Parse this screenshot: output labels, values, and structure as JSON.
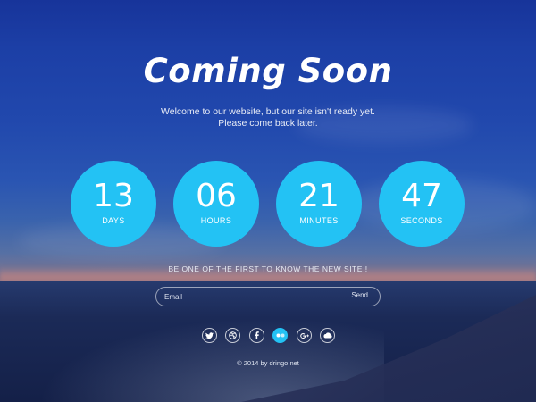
{
  "header": {
    "title": "Coming Soon",
    "subtitle_line1": "Welcome to our website, but our site isn't ready yet.",
    "subtitle_line2": "Please come back later."
  },
  "countdown": [
    {
      "value": "13",
      "label": "DAYS"
    },
    {
      "value": "06",
      "label": "HOURS"
    },
    {
      "value": "21",
      "label": "MINUTES"
    },
    {
      "value": "47",
      "label": "SECONDS"
    }
  ],
  "newsletter": {
    "tagline": "BE ONE OF THE FIRST TO KNOW THE NEW SITE !",
    "email_placeholder": "Email",
    "send_label": "Send"
  },
  "social": [
    {
      "icon": "twitter-icon",
      "active": false
    },
    {
      "icon": "dribbble-icon",
      "active": false
    },
    {
      "icon": "facebook-icon",
      "active": false
    },
    {
      "icon": "flickr-icon",
      "active": true
    },
    {
      "icon": "google-plus-icon",
      "active": false
    },
    {
      "icon": "cloud-icon",
      "active": false
    }
  ],
  "footer": {
    "copyright": "© 2014 by dringo.net"
  },
  "colors": {
    "accent": "#23c2f4",
    "background_top": "#17349a",
    "background_bottom": "#121c3b"
  }
}
